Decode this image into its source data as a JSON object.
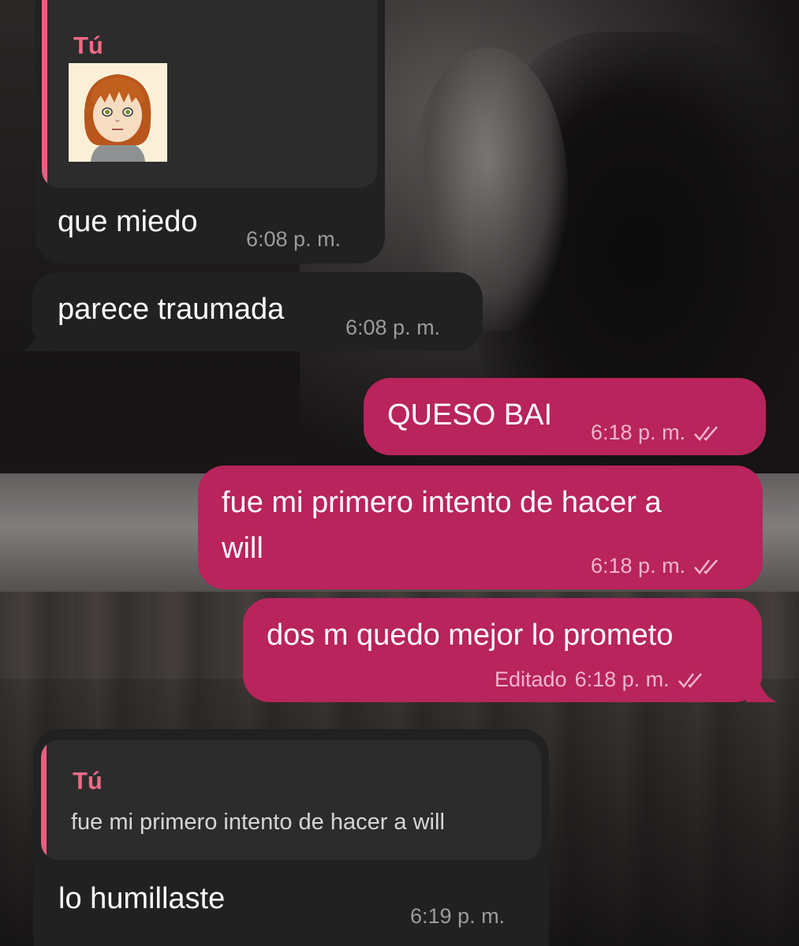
{
  "messages": {
    "m1": {
      "reply_author": "Tú",
      "text": "que miedo",
      "time": "6:08 p. m."
    },
    "m2": {
      "text": "parece traumada",
      "time": "6:08 p. m."
    },
    "m3": {
      "text": "QUESO BAI",
      "time": "6:18 p. m."
    },
    "m4": {
      "text_line1": "fue mi primero intento de hacer a",
      "text_line2": "will",
      "time": "6:18 p. m."
    },
    "m5": {
      "text": "dos m quedo mejor lo prometo",
      "edited": "Editado",
      "time": "6:18 p. m."
    },
    "m6": {
      "reply_author": "Tú",
      "reply_text": "fue mi primero intento de hacer a will",
      "text": "lo humillaste",
      "time": "6:19 p. m."
    }
  },
  "colors": {
    "incoming_bubble": "#212121",
    "outgoing_bubble": "#b8245b",
    "reply_accent": "#e8607f"
  },
  "icons": {
    "read_receipt": "double-check-icon",
    "quoted_media": "avatar-sticker"
  }
}
